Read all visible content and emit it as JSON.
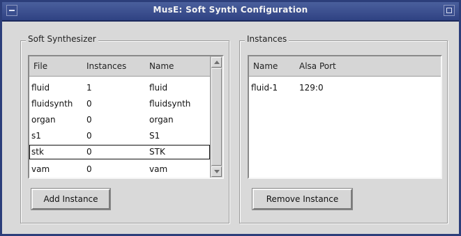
{
  "window": {
    "title": "MusE: Soft Synth Configuration"
  },
  "soft_synth": {
    "group_title": "Soft Synthesizer",
    "columns": [
      "File",
      "Instances",
      "Name"
    ],
    "rows": [
      {
        "file": "fluid",
        "instances": "1",
        "name": "fluid"
      },
      {
        "file": "fluidsynth",
        "instances": "0",
        "name": "fluidsynth"
      },
      {
        "file": "organ",
        "instances": "0",
        "name": "organ"
      },
      {
        "file": "s1",
        "instances": "0",
        "name": "S1"
      },
      {
        "file": "stk",
        "instances": "0",
        "name": "STK"
      },
      {
        "file": "vam",
        "instances": "0",
        "name": "vam"
      }
    ],
    "selected_row": 4,
    "add_button": "Add Instance"
  },
  "instances": {
    "group_title": "Instances",
    "columns": [
      "Name",
      "Alsa Port"
    ],
    "rows": [
      {
        "name": "fluid-1",
        "port": "129:0"
      }
    ],
    "remove_button": "Remove Instance"
  }
}
